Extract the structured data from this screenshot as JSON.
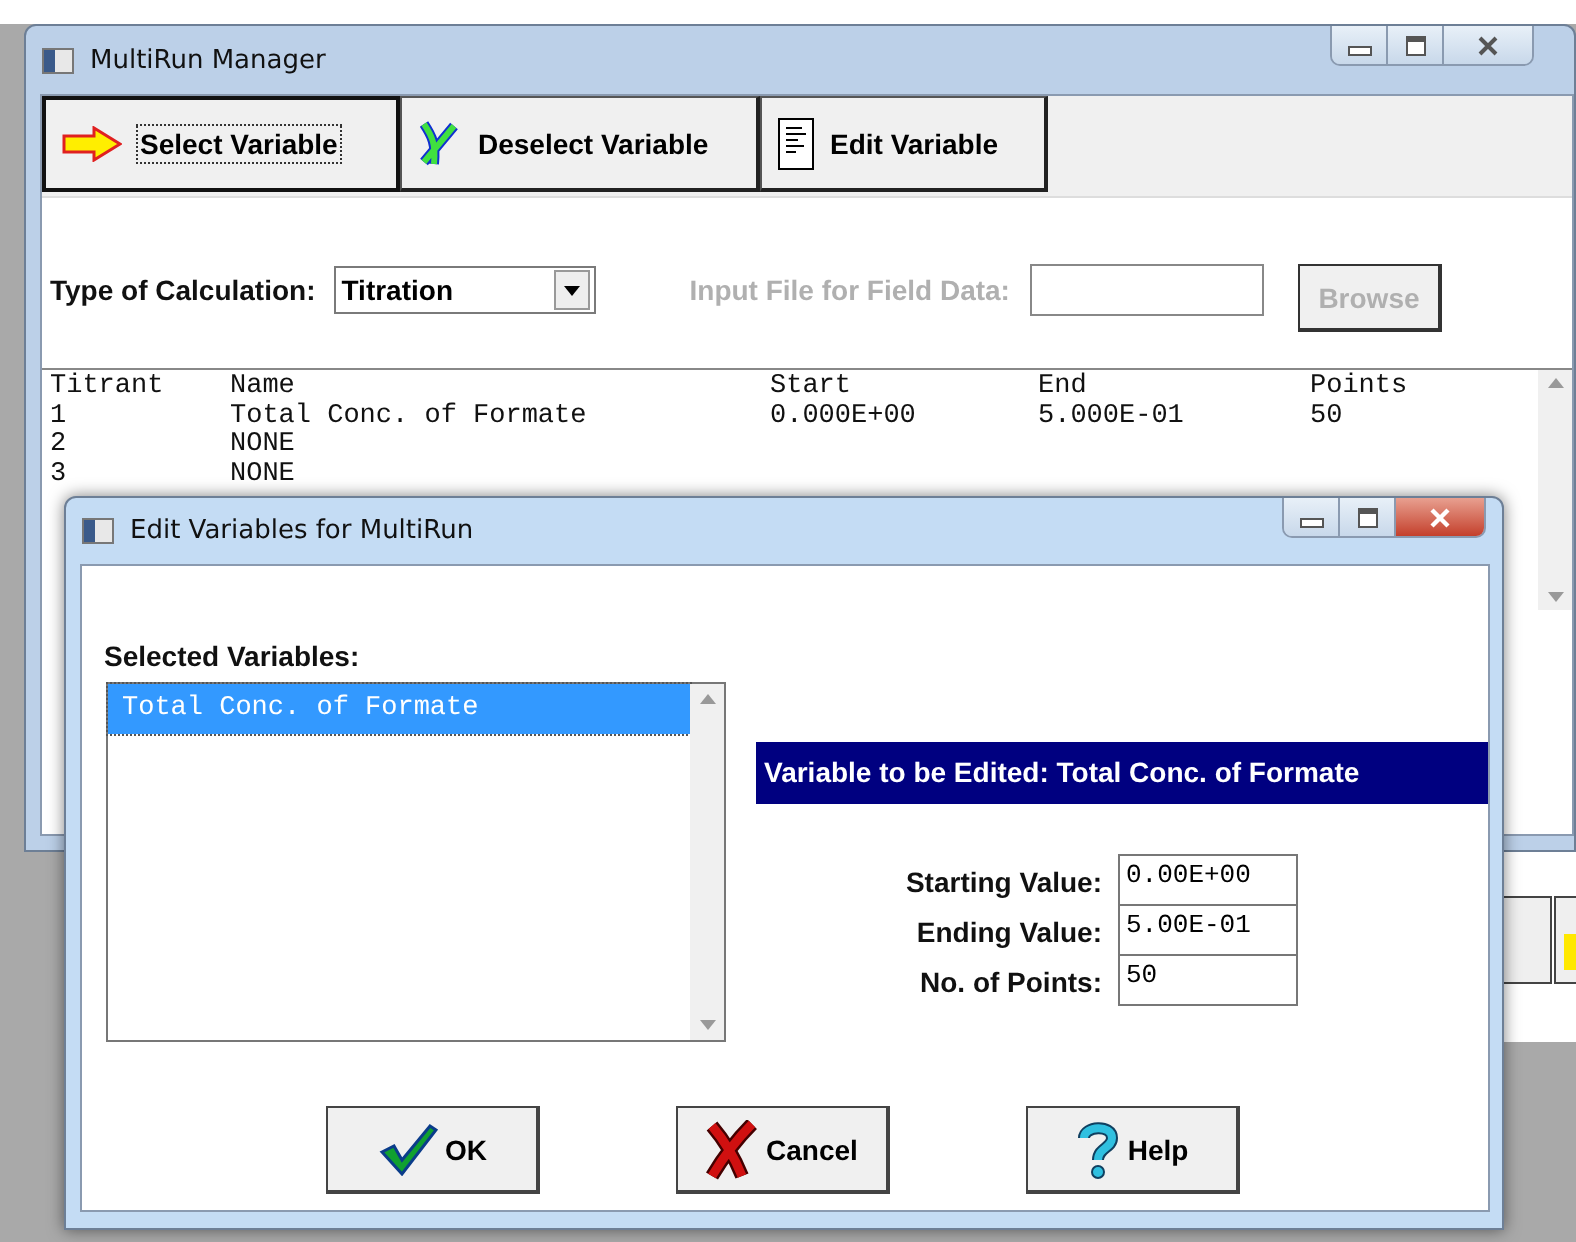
{
  "main_window": {
    "title": "MultiRun Manager",
    "toolbar": [
      {
        "label": "Select Variable",
        "kind": "select",
        "focused": true
      },
      {
        "label": "Deselect Variable",
        "kind": "deselect",
        "focused": false
      },
      {
        "label": "Edit Variable",
        "kind": "edit",
        "focused": false
      }
    ],
    "calculation": {
      "label": "Type of Calculation:",
      "value": "Titration"
    },
    "field_data": {
      "label": "Input File for Field Data:",
      "disabled": true
    },
    "browse_button": {
      "label": "Browse",
      "disabled": true
    },
    "listing": {
      "columns": [
        "Titrant",
        "Name",
        "Start",
        "End",
        "Points"
      ],
      "rows": [
        [
          "1",
          "Total Conc. of Formate",
          "0.000E+00",
          "5.000E-01",
          "50"
        ],
        [
          "2",
          "NONE",
          "",
          "",
          ""
        ],
        [
          "3",
          "NONE",
          "",
          "",
          ""
        ]
      ]
    }
  },
  "dialog": {
    "title": "Edit Variables for MultiRun",
    "list_label": "Selected Variables:",
    "list_items": [
      {
        "label": "Total Conc. of Formate",
        "selected": true
      }
    ],
    "banner": "Variable to be Edited: Total Conc. of Formate",
    "fields": [
      {
        "label": "Starting Value:",
        "value": "0.00E+00"
      },
      {
        "label": "Ending Value:",
        "value": "5.00E-01"
      },
      {
        "label": "No. of Points:",
        "value": "50"
      }
    ],
    "buttons": [
      {
        "label": "OK",
        "kind": "ok"
      },
      {
        "label": "Cancel",
        "kind": "cancel"
      },
      {
        "label": "Help",
        "kind": "help"
      }
    ]
  }
}
